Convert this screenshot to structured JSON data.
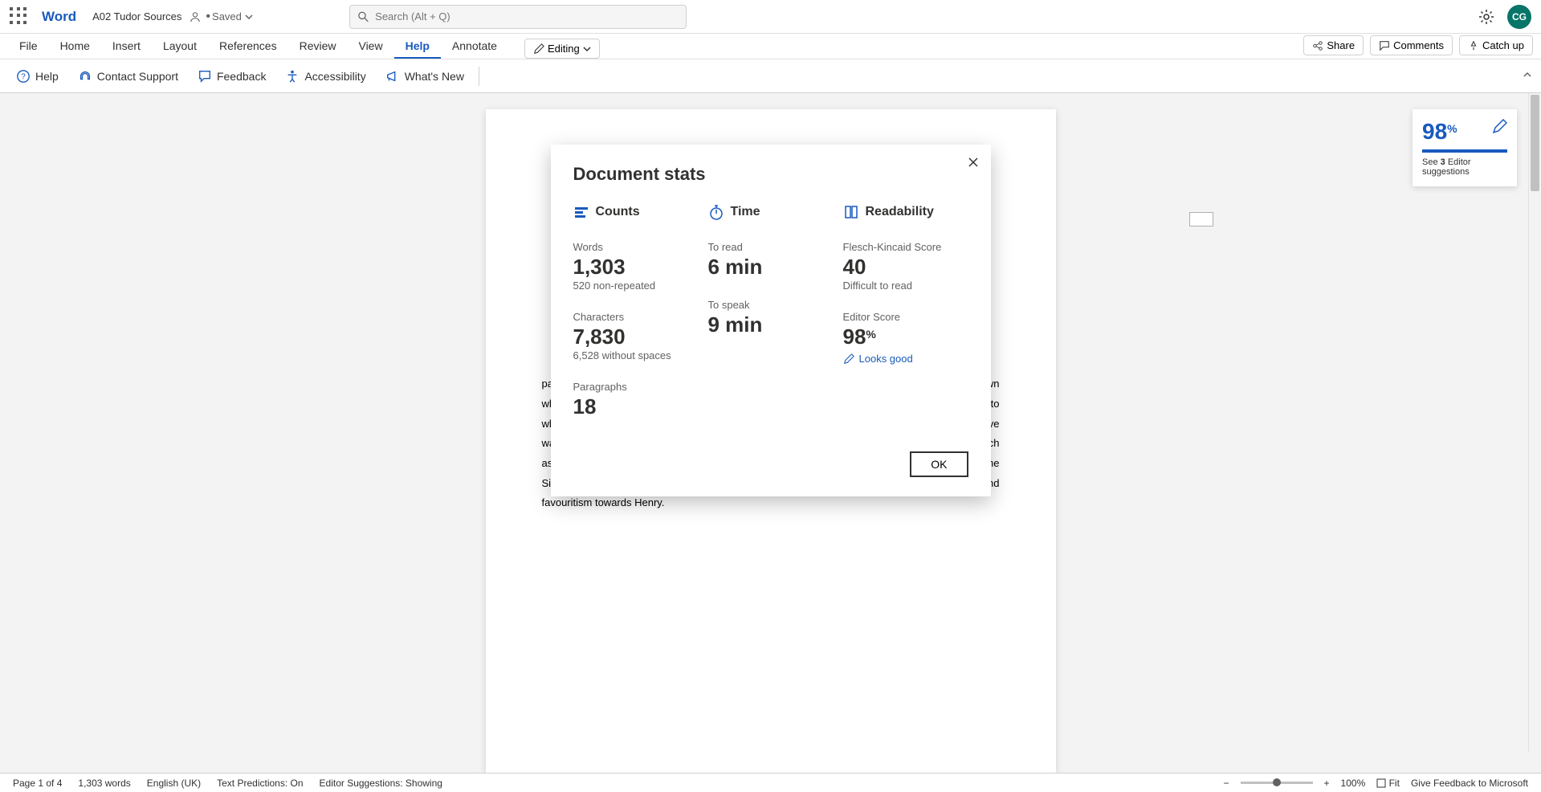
{
  "app": {
    "name": "Word",
    "doc_title": "A02 Tudor Sources",
    "saved_label": "Saved",
    "search_placeholder": "Search (Alt + Q)",
    "avatar_initials": "CG"
  },
  "tabs": {
    "items": [
      "File",
      "Home",
      "Insert",
      "Layout",
      "References",
      "Review",
      "View",
      "Help",
      "Annotate"
    ],
    "active_index": 7,
    "editing_btn": "Editing",
    "share": "Share",
    "comments": "Comments",
    "catchup": "Catch up"
  },
  "ribbon": {
    "help": "Help",
    "contact": "Contact Support",
    "feedback": "Feedback",
    "accessibility": "Accessibility",
    "whatsnew": "What's New"
  },
  "editor_badge": {
    "score": "98",
    "pct": "%",
    "prefix": "See ",
    "count": "3",
    "suffix": " Editor suggestions"
  },
  "modal": {
    "title": "Document stats",
    "counts_header": "Counts",
    "time_header": "Time",
    "readability_header": "Readability",
    "words_label": "Words",
    "words_value": "1,303",
    "words_sub": "520 non-repeated",
    "chars_label": "Characters",
    "chars_value": "7,830",
    "chars_sub": "6,528 without spaces",
    "paras_label": "Paragraphs",
    "paras_value": "18",
    "toread_label": "To read",
    "toread_value": "6 min",
    "tospeak_label": "To speak",
    "tospeak_value": "9 min",
    "fk_label": "Flesch-Kincaid Score",
    "fk_value": "40",
    "fk_sub": "Difficult to read",
    "es_label": "Editor Score",
    "es_value": "98",
    "es_pct": "%",
    "looks_good": "Looks good",
    "ok": "OK"
  },
  "document": {
    "para1_visible": "painted Henry negatively – leading to some accounts to be inaccurate; for example, it is unknown whether 'the Earl [of Lincoln] planned to seize the throne himself in the event of victory' contrary to what the source states. Instead, Lincoln was another Yorkist – so it is likely that Henry will have wanted to dampen any credibility the Yorkists have left to prevent any other dynastic uprisings such as this one, rather than this prioritising accuracy. As there is no source from any rebels from the Simnel Rebellion, and plenty from members of Henry's court, this further implies inaccuracy and favouritism towards Henry."
  },
  "status": {
    "page": "Page 1 of 4",
    "words": "1,303 words",
    "lang": "English (UK)",
    "predictions": "Text Predictions: On",
    "suggestions": "Editor Suggestions: Showing",
    "zoom": "100%",
    "fit": "Fit",
    "feedback": "Give Feedback to Microsoft"
  }
}
